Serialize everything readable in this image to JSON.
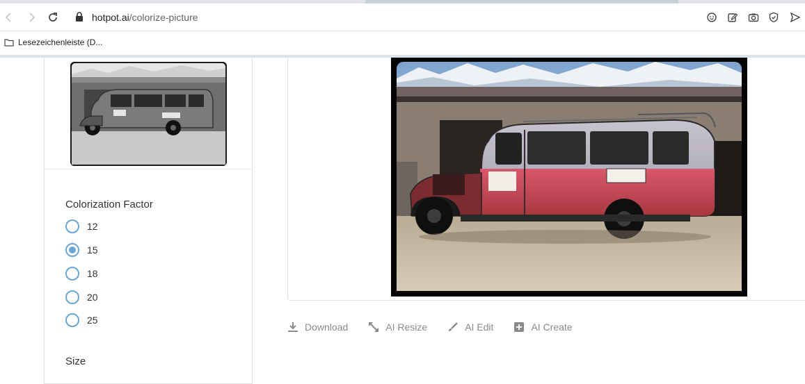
{
  "browser": {
    "url_domain": "hotpot.ai",
    "url_path": "/colorize-picture",
    "bookmark_folder": "Lesezeichenleiste (D..."
  },
  "left_panel": {
    "colorization_title": "Colorization Factor",
    "options": [
      "12",
      "15",
      "18",
      "20",
      "25"
    ],
    "selected": "15",
    "size_title": "Size"
  },
  "actions": {
    "download": "Download",
    "resize": "AI Resize",
    "edit": "AI Edit",
    "create": "AI Create"
  },
  "colors": {
    "accent": "#6aa6d4",
    "action_text": "#8a8a8a"
  }
}
